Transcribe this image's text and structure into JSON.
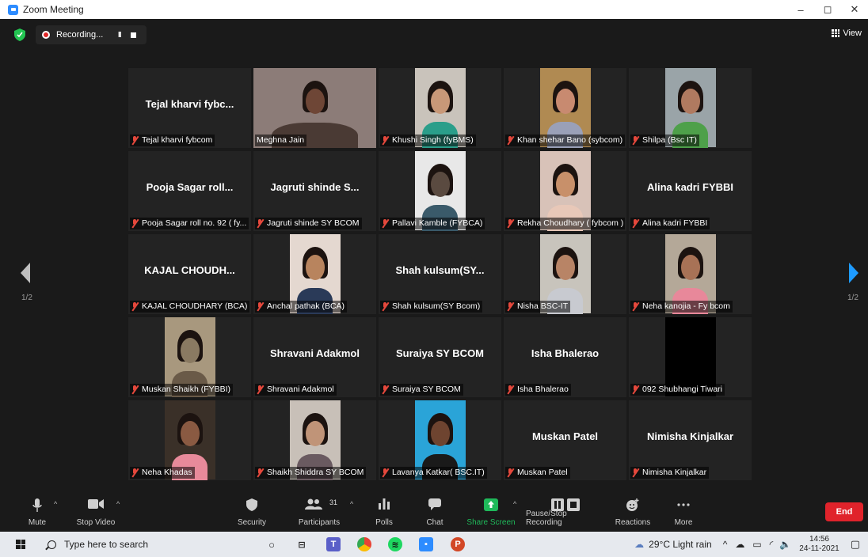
{
  "window": {
    "title": "Zoom Meeting",
    "minimize": "–",
    "maximize": "◻",
    "close": "✕"
  },
  "topbar": {
    "recording_text": "Recording...",
    "pause_symbol": "II",
    "view_label": "View"
  },
  "pagination": {
    "left": "1/2",
    "right": "1/2"
  },
  "participants": [
    {
      "name": "Tejal kharvi fybcom",
      "big": "Tejal kharvi fybc...",
      "video": false
    },
    {
      "name": "Meghna Jain",
      "big": "",
      "video": true,
      "active": true,
      "bg": "#8c7c78",
      "skin": "#6e4636",
      "shirt": "#4a3a34",
      "mic_off": false
    },
    {
      "name": "Khushi Singh (fyBMS)",
      "big": "",
      "video": true,
      "bg": "#c9c3bb",
      "skin": "#c89878",
      "shirt": "#2a9e8a"
    },
    {
      "name": "Khan shehar Bano (sybcom)",
      "big": "",
      "video": true,
      "bg": "#b08a52",
      "skin": "#c88a70",
      "shirt": "#9aa0b8"
    },
    {
      "name": "Shilpa (Bsc IT)",
      "big": "",
      "video": true,
      "bg": "#9aa4a8",
      "skin": "#b07a60",
      "shirt": "#4ea04a"
    },
    {
      "name": "Pooja Sagar roll no. 92 ( fy...",
      "big": "Pooja Sagar roll...",
      "video": false
    },
    {
      "name": "Jagruti shinde SY BCOM",
      "big": "Jagruti shinde S...",
      "video": false
    },
    {
      "name": "Pallavi Kamble (FYBCA)",
      "big": "",
      "video": true,
      "bg": "#e8e8e8",
      "skin": "#5a4a40",
      "shirt": "#3a5a6a"
    },
    {
      "name": "Rekha Choudhary ( fybcom )",
      "big": "",
      "video": true,
      "bg": "#d8c2b8",
      "skin": "#c8906a",
      "shirt": "#e8c8b8"
    },
    {
      "name": "Alina kadri FYBBI",
      "big": "Alina kadri FYBBI",
      "video": false
    },
    {
      "name": "KAJAL CHOUDHARY (BCA)",
      "big": "KAJAL CHOUDH...",
      "video": false
    },
    {
      "name": "Anchal pathak (BCA)",
      "big": "",
      "video": true,
      "bg": "#e4d8d0",
      "skin": "#b8845e",
      "shirt": "#2a3a58"
    },
    {
      "name": "Shah kulsum(SY Bcom)",
      "big": "Shah kulsum(SY...",
      "video": false
    },
    {
      "name": "Nisha BSC-IT",
      "big": "",
      "video": true,
      "bg": "#c8c4bc",
      "skin": "#b88466",
      "shirt": "#c8cad0"
    },
    {
      "name": "Neha kanojia - Fy bcom",
      "big": "",
      "video": true,
      "bg": "#b4a898",
      "skin": "#a87256",
      "shirt": "#e8889a"
    },
    {
      "name": "Muskan Shaikh (FYBBI)",
      "big": "",
      "video": true,
      "bg": "#a8987e",
      "skin": "#8a7a62",
      "shirt": "#6a5a48"
    },
    {
      "name": "Shravani Adakmol",
      "big": "Shravani Adakmol",
      "video": false
    },
    {
      "name": "Suraiya SY BCOM",
      "big": "Suraiya SY BCOM",
      "video": false
    },
    {
      "name": "Isha Bhalerao",
      "big": "Isha Bhalerao",
      "video": false
    },
    {
      "name": "092 Shubhangi Tiwari",
      "big": "",
      "video": true,
      "bg": "#000000",
      "skin": "#000000",
      "shirt": "#000000",
      "dark": true
    },
    {
      "name": "Neha Khadas",
      "big": "",
      "video": true,
      "bg": "#3a3028",
      "skin": "#8a5a42",
      "shirt": "#e88a9a"
    },
    {
      "name": "Shaikh Shiddra SY BCOM",
      "big": "",
      "video": true,
      "bg": "#c8c0b8",
      "skin": "#c09478",
      "shirt": "#6a5a60"
    },
    {
      "name": "Lavanya Katkar( BSC.IT)",
      "big": "",
      "video": true,
      "bg": "#2aa4d8",
      "skin": "#6e4430",
      "shirt": "#1a1a1a"
    },
    {
      "name": "Muskan Patel",
      "big": "Muskan Patel",
      "video": false
    },
    {
      "name": "Nimisha Kinjalkar",
      "big": "Nimisha Kinjalkar",
      "video": false
    }
  ],
  "toolbar": {
    "mute": "Mute",
    "stop_video": "Stop Video",
    "security": "Security",
    "participants": "Participants",
    "participants_count": "31",
    "polls": "Polls",
    "chat": "Chat",
    "share_screen": "Share Screen",
    "pause_stop_recording": "Pause/Stop Recording",
    "reactions": "Reactions",
    "more": "More",
    "end": "End"
  },
  "taskbar": {
    "search_placeholder": "Type here to search",
    "weather": "29°C  Light rain",
    "time": "14:56",
    "date": "24-11-2021"
  },
  "colors": {
    "accent": "#2d8cff",
    "share_green": "#1fb95a",
    "end_red": "#e0232b",
    "active_outline": "#c4e45a"
  }
}
